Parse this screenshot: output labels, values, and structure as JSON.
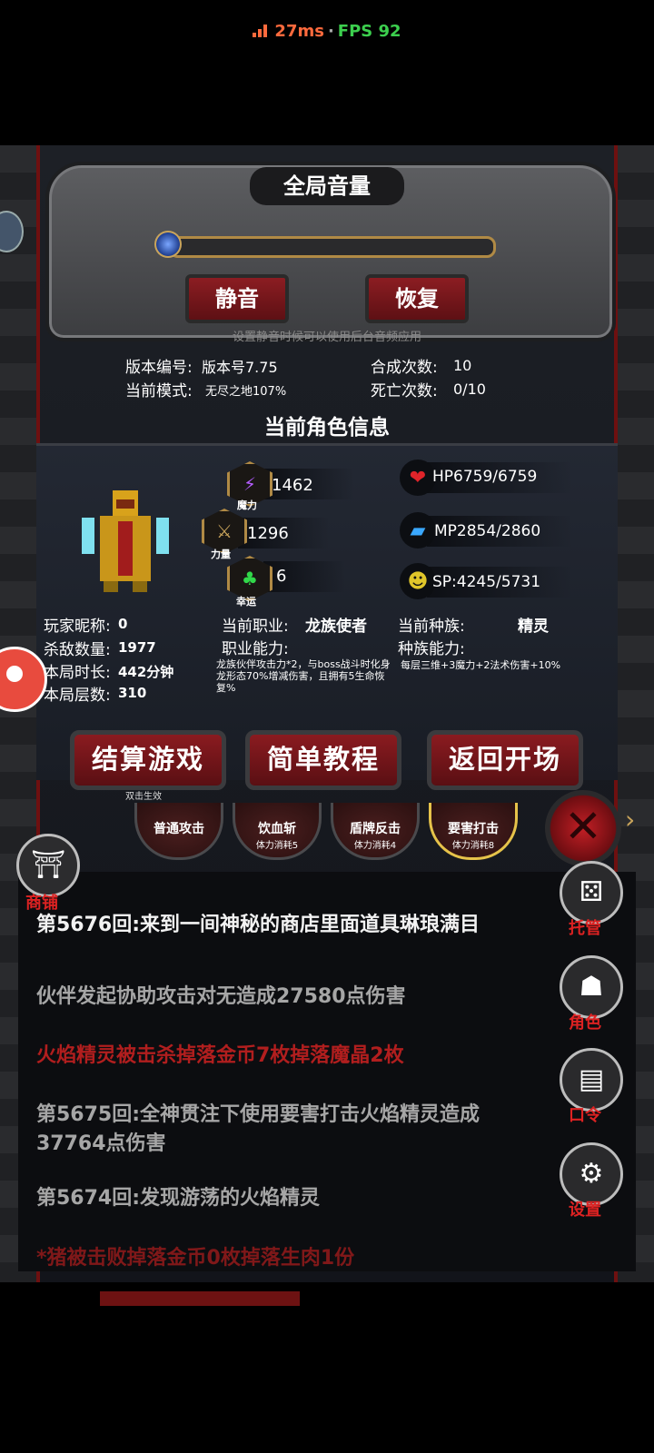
{
  "status": {
    "ping": "27ms",
    "separator": "·",
    "fps": "FPS 92"
  },
  "volume": {
    "title": "全局音量",
    "mute_label": "静音",
    "restore_label": "恢复",
    "hint": "设置静音时候可以使用后台音频应用",
    "level": 0.0
  },
  "game_info": {
    "version_label": "版本编号:",
    "version_value": "版本号7.75",
    "mode_label": "当前模式:",
    "mode_value": "无尽之地107%",
    "craft_label": "合成次数:",
    "craft_value": "10",
    "death_label": "死亡次数:",
    "death_value": "0/10"
  },
  "character": {
    "section_title": "当前角色信息",
    "stats": {
      "magic_label": "魔力",
      "magic_value": "1462",
      "strength_label": "力量",
      "strength_value": "1296",
      "luck_label": "幸运",
      "luck_value": "6"
    },
    "hp": "HP6759/6759",
    "mp": "MP2854/2860",
    "sp": "SP:4245/5731",
    "nickname_label": "玩家昵称:",
    "nickname_value": "0",
    "kills_label": "杀敌数量:",
    "kills_value": "1977",
    "duration_label": "本局时长:",
    "duration_value": "442分钟",
    "floors_label": "本局层数:",
    "floors_value": "310",
    "job_label": "当前职业:",
    "job_value": "龙族使者",
    "job_ability_label": "职业能力:",
    "job_ability_desc": "龙族伙伴攻击力*2，与boss战斗时化身龙形态70%增减伤害，且拥有5生命恢复%",
    "race_label": "当前种族:",
    "race_value": "精灵",
    "race_ability_label": "种族能力:",
    "race_ability_desc": "每层三维+3魔力+2法术伤害+10%"
  },
  "actions": {
    "settle_label": "结算游戏",
    "settle_hint": "双击生效",
    "tutorial_label": "简单教程",
    "back_label": "返回开场"
  },
  "skills": [
    {
      "name": "普通攻击",
      "cost": ""
    },
    {
      "name": "饮血斩",
      "cost": "体力消耗5"
    },
    {
      "name": "盾牌反击",
      "cost": "体力消耗4"
    },
    {
      "name": "要害打击",
      "cost": "体力消耗8"
    }
  ],
  "side_menu": {
    "shop": "商铺",
    "auto": "托管",
    "role": "角色",
    "code": "口令",
    "settings": "设置"
  },
  "log": [
    {
      "text": "第5676回:来到一间神秘的商店里面道具琳琅满目",
      "color": "white"
    },
    {
      "text": "伙伴发起协助攻击对无造成27580点伤害",
      "color": "gray"
    },
    {
      "text": "火焰精灵被击杀掉落金币7枚掉落魔晶2枚",
      "color": "red"
    },
    {
      "text": "第5675回:全神贯注下使用要害打击火焰精灵造成37764点伤害",
      "color": "gray"
    },
    {
      "text": "第5674回:发现游荡的火焰精灵",
      "color": "gray"
    },
    {
      "text": "*猪被击败掉落金币0枚掉落生肉1份",
      "color": "red"
    }
  ],
  "colors": {
    "accent_red": "#8c1d22",
    "gold": "#b08a45",
    "log_red": "#b11e1e"
  }
}
